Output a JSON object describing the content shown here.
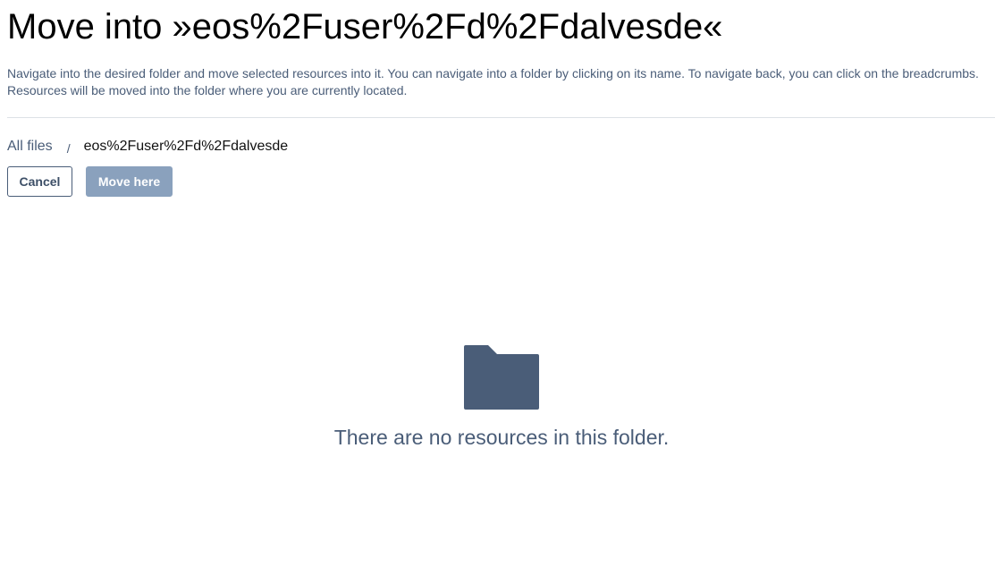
{
  "header": {
    "title": "Move into »eos%2Fuser%2Fd%2Fdalvesde«",
    "description": "Navigate into the desired folder and move selected resources into it. You can navigate into a folder by clicking on its name. To navigate back, you can click on the breadcrumbs. Resources will be moved into the folder where you are currently located."
  },
  "breadcrumb": {
    "root_label": "All files",
    "separator": "/",
    "current_label": "eos%2Fuser%2Fd%2Fdalvesde"
  },
  "actions": {
    "cancel_label": "Cancel",
    "move_label": "Move here"
  },
  "empty_state": {
    "icon": "folder-icon",
    "message": "There are no resources in this folder."
  },
  "colors": {
    "text_primary": "#000000",
    "text_muted": "#4a5d78",
    "primary_button_disabled": "#8aa1bd",
    "folder_icon": "#4a5d78",
    "divider": "#dde1e6"
  }
}
